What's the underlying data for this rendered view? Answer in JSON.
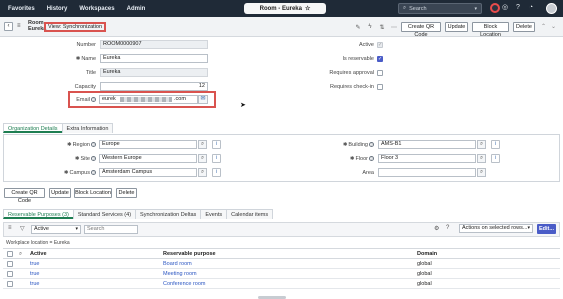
{
  "topnav": {
    "items": [
      "Favorites",
      "History",
      "Workspaces",
      "Admin"
    ],
    "title": "Room - Eureka",
    "search_placeholder": "Search"
  },
  "header": {
    "record_type_line1": "Room",
    "record_type_line2": "Eureka",
    "view_label": "View: Synchronization",
    "buttons": [
      "Create QR Code",
      "Update",
      "Block Location",
      "Delete"
    ]
  },
  "form": {
    "number": {
      "label": "Number",
      "value": "ROOM0000907"
    },
    "name": {
      "label": "Name",
      "value": "Eureka"
    },
    "title": {
      "label": "Title",
      "value": "Eureka"
    },
    "capacity": {
      "label": "Capacity",
      "value": "12"
    },
    "email": {
      "label": "Email",
      "prefix": "eurek",
      "suffix": ".com"
    },
    "active": {
      "label": "Active",
      "checked": true
    },
    "is_reservable": {
      "label": "Is reservable",
      "checked": true
    },
    "requires_approval": {
      "label": "Requires approval",
      "checked": false
    },
    "requires_checkin": {
      "label": "Requires check-in",
      "checked": false
    }
  },
  "section_tabs": [
    "Organization Details",
    "Extra Information"
  ],
  "org": {
    "region": {
      "label": "Region",
      "value": "Europe"
    },
    "site": {
      "label": "Site",
      "value": "Western Europe"
    },
    "campus": {
      "label": "Campus",
      "value": "Amsterdam Campus"
    },
    "building": {
      "label": "Building",
      "value": "AMS-B1"
    },
    "floor": {
      "label": "Floor",
      "value": "Floor 3"
    },
    "area": {
      "label": "Area",
      "value": ""
    }
  },
  "bottom_buttons": [
    "Create QR Code",
    "Update",
    "Block Location",
    "Delete"
  ],
  "related_tabs": [
    "Reservable Purposes (3)",
    "Standard Services (4)",
    "Synchronization Deltas",
    "Events",
    "Calendar items"
  ],
  "list": {
    "filter_field": "Active",
    "search_placeholder": "Search",
    "actions_label": "Actions on selected rows...",
    "edit_label": "Edit...",
    "breadcrumb": "Workplace location = Eureka",
    "columns": [
      "Active",
      "Reservable purpose",
      "Domain"
    ],
    "rows": [
      {
        "active": "true",
        "purpose": "Board room",
        "domain": "global"
      },
      {
        "active": "true",
        "purpose": "Meeting room",
        "domain": "global"
      },
      {
        "active": "true",
        "purpose": "Conference room",
        "domain": "global"
      }
    ]
  },
  "colors": {
    "nav_bg": "#1f2a37",
    "accent_green": "#1e7e52",
    "highlight_red": "#d9534f",
    "primary_blue": "#4a5cc7",
    "link": "#2b56c2"
  }
}
